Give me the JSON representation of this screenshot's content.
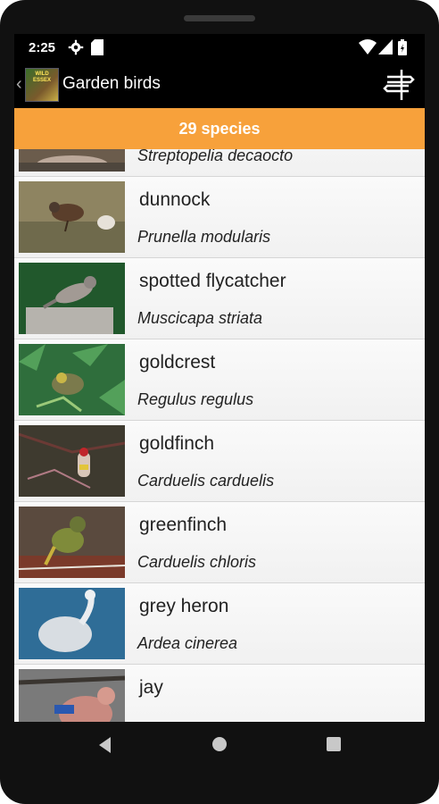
{
  "status": {
    "time": "2:25",
    "icons": [
      "gear-icon",
      "sd-card-icon",
      "wifi-icon",
      "signal-icon",
      "battery-icon"
    ]
  },
  "appbar": {
    "logo_text": "WILD ESSEX",
    "title": "Garden birds",
    "menu_icon": "signpost-icon"
  },
  "subheader": {
    "label": "29 species"
  },
  "species": [
    {
      "common": "",
      "latin": "Streptopelia decaocto"
    },
    {
      "common": "dunnock",
      "latin": "Prunella modularis"
    },
    {
      "common": "spotted flycatcher",
      "latin": "Muscicapa striata"
    },
    {
      "common": "goldcrest",
      "latin": "Regulus regulus"
    },
    {
      "common": "goldfinch",
      "latin": "Carduelis carduelis"
    },
    {
      "common": "greenfinch",
      "latin": "Carduelis chloris"
    },
    {
      "common": "grey heron",
      "latin": "Ardea cinerea"
    },
    {
      "common": "jay",
      "latin": ""
    }
  ],
  "colors": {
    "accent": "#f7a13b",
    "appbar": "#000000",
    "list_bg": "#f5f5f5"
  }
}
